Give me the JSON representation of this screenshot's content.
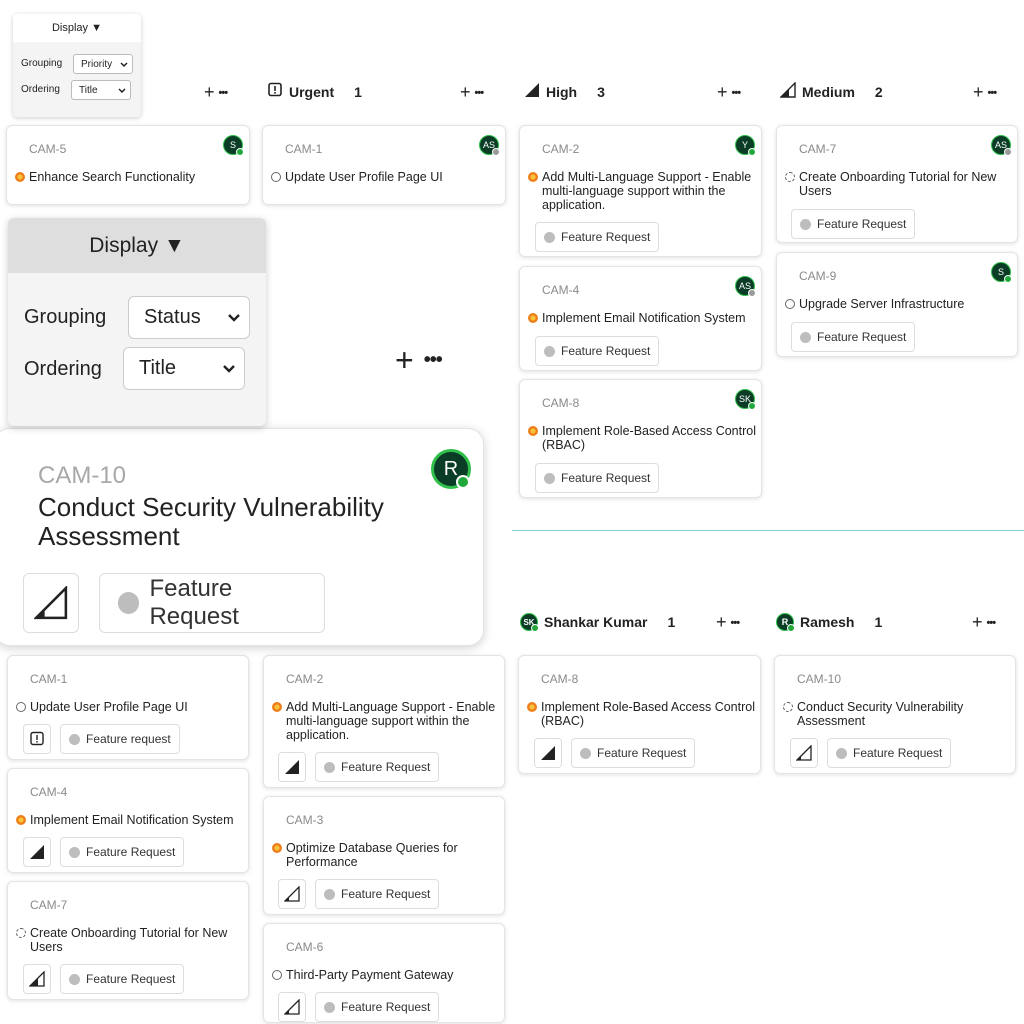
{
  "small_display": {
    "button": "Display ▼",
    "grouping_label": "Grouping",
    "grouping_value": "Priority",
    "ordering_label": "Ordering",
    "ordering_value": "Title"
  },
  "big_display": {
    "button": "Display ▼",
    "grouping_label": "Grouping",
    "grouping_value": "Status",
    "ordering_label": "Ordering",
    "ordering_value": "Title"
  },
  "top_columns": [
    {
      "name": "Urgent",
      "count": "1"
    },
    {
      "name": "High",
      "count": "3"
    },
    {
      "name": "Medium",
      "count": "2"
    }
  ],
  "user_columns": [
    {
      "initials": "SK",
      "name": "Shankar Kumar",
      "count": "1"
    },
    {
      "initials": "R",
      "name": "Ramesh",
      "count": "1"
    }
  ],
  "action_add": "+",
  "action_more": "•••",
  "cards": {
    "cam5": {
      "id": "CAM-5",
      "title": "Enhance Search Functionality",
      "avatar": "S"
    },
    "cam1_top": {
      "id": "CAM-1",
      "title": "Update User Profile Page UI",
      "avatar": "AS"
    },
    "cam2_top": {
      "id": "CAM-2",
      "title": "Add Multi-Language Support - Enable multi-language support within the application.",
      "avatar": "Y",
      "tag": "Feature Request"
    },
    "cam4_top": {
      "id": "CAM-4",
      "title": "Implement Email Notification System",
      "avatar": "AS",
      "tag": "Feature Request"
    },
    "cam8_top": {
      "id": "CAM-8",
      "title": "Implement Role-Based Access Control (RBAC)",
      "avatar": "SK",
      "tag": "Feature Request"
    },
    "cam7_top": {
      "id": "CAM-7",
      "title": "Create Onboarding Tutorial for New Users",
      "avatar": "AS",
      "tag": "Feature Request"
    },
    "cam9_top": {
      "id": "CAM-9",
      "title": "Upgrade Server Infrastructure",
      "avatar": "S",
      "tag": "Feature Request"
    },
    "cam10_big": {
      "id": "CAM-10",
      "title": "Conduct Security Vulnerability Assessment",
      "avatar": "R",
      "tag": "Feature Request"
    },
    "cam1_bot": {
      "id": "CAM-1",
      "title": "Update User Profile Page UI",
      "tag": "Feature request"
    },
    "cam4_bot": {
      "id": "CAM-4",
      "title": "Implement Email Notification System",
      "tag": "Feature Request"
    },
    "cam7_bot": {
      "id": "CAM-7",
      "title": "Create Onboarding Tutorial for New Users",
      "tag": "Feature Request"
    },
    "cam2_bot": {
      "id": "CAM-2",
      "title": "Add Multi-Language Support - Enable multi-language support within the application.",
      "tag": "Feature Request"
    },
    "cam3_bot": {
      "id": "CAM-3",
      "title": "Optimize Database Queries for Performance",
      "tag": "Feature Request"
    },
    "cam6_bot": {
      "id": "CAM-6",
      "title": "Third-Party Payment Gateway",
      "tag": "Feature Request"
    },
    "cam8_bot": {
      "id": "CAM-8",
      "title": "Implement Role-Based Access Control (RBAC)",
      "tag": "Feature Request"
    },
    "cam10_bot": {
      "id": "CAM-10",
      "title": "Conduct Security Vulnerability Assessment",
      "tag": "Feature Request"
    }
  },
  "colors": {
    "avatar_bg": "#0b3d26",
    "online": "#22a83a",
    "divider": "#7fd6d6"
  }
}
